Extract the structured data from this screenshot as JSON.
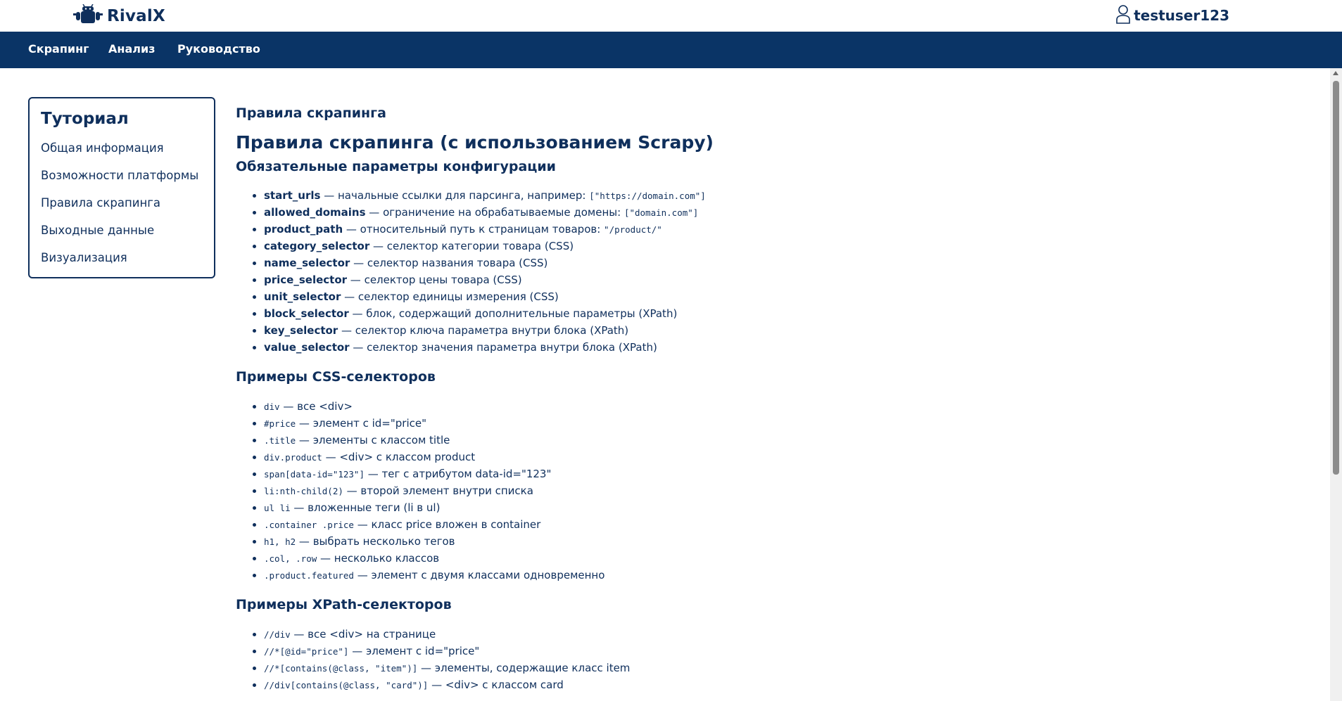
{
  "brand": {
    "name": "RivalX",
    "logo_icon": "robot-logo-icon"
  },
  "user": {
    "name": "testuser123",
    "icon": "user-icon"
  },
  "nav": {
    "items": [
      "Скрапинг",
      "Анализ",
      "Руководство"
    ]
  },
  "sidebar": {
    "title": "Туториал",
    "items": [
      "Общая информация",
      "Возможности платформы",
      "Правила скрапинга",
      "Выходные данные",
      "Визуализация"
    ]
  },
  "content": {
    "page_title": "Правила скрапинга",
    "main_heading": "Правила скрапинга (с использованием Scrapy)",
    "config_heading": "Обязательные параметры конфигурации",
    "config_params": [
      {
        "name": "start_urls",
        "desc": " — начальные ссылки для парсинга, например: ",
        "code": "[\"https://domain.com\"]"
      },
      {
        "name": "allowed_domains",
        "desc": " — ограничение на обрабатываемые домены: ",
        "code": "[\"domain.com\"]"
      },
      {
        "name": "product_path",
        "desc": " — относительный путь к страницам товаров: ",
        "code": "\"/product/\""
      },
      {
        "name": "category_selector",
        "desc": " — селектор категории товара (CSS)",
        "code": ""
      },
      {
        "name": "name_selector",
        "desc": " — селектор названия товара (CSS)",
        "code": ""
      },
      {
        "name": "price_selector",
        "desc": " — селектор цены товара (CSS)",
        "code": ""
      },
      {
        "name": "unit_selector",
        "desc": " — селектор единицы измерения (CSS)",
        "code": ""
      },
      {
        "name": "block_selector",
        "desc": " — блок, содержащий дополнительные параметры (XPath)",
        "code": ""
      },
      {
        "name": "key_selector",
        "desc": " — селектор ключа параметра внутри блока (XPath)",
        "code": ""
      },
      {
        "name": "value_selector",
        "desc": " — селектор значения параметра внутри блока (XPath)",
        "code": ""
      }
    ],
    "css_heading": "Примеры CSS-селекторов",
    "css_examples": [
      {
        "code": "div",
        "desc": " — все <div>"
      },
      {
        "code": "#price",
        "desc": " — элемент с id=\"price\""
      },
      {
        "code": ".title",
        "desc": " — элементы с классом title"
      },
      {
        "code": "div.product",
        "desc": " — <div> с классом product"
      },
      {
        "code": "span[data-id=\"123\"]",
        "desc": " — тег с атрибутом data-id=\"123\""
      },
      {
        "code": "li:nth-child(2)",
        "desc": " — второй элемент внутри списка"
      },
      {
        "code": "ul li",
        "desc": " — вложенные теги (li в ul)"
      },
      {
        "code": ".container .price",
        "desc": " — класс price вложен в container"
      },
      {
        "code": "h1, h2",
        "desc": " — выбрать несколько тегов"
      },
      {
        "code": ".col, .row",
        "desc": " — несколько классов"
      },
      {
        "code": ".product.featured",
        "desc": " — элемент с двумя классами одновременно"
      }
    ],
    "xpath_heading": "Примеры XPath-селекторов",
    "xpath_examples": [
      {
        "code": "//div",
        "desc": " — все <div> на странице"
      },
      {
        "code": "//*[@id=\"price\"]",
        "desc": " — элемент с id=\"price\""
      },
      {
        "code": "//*[contains(@class, \"item\")]",
        "desc": " — элементы, содержащие класс item"
      },
      {
        "code": "//div[contains(@class, \"card\")]",
        "desc": " — <div> с классом card"
      }
    ]
  },
  "colors": {
    "primary": "#0a3466",
    "text": "#0f2f5c",
    "background": "#ffffff"
  }
}
